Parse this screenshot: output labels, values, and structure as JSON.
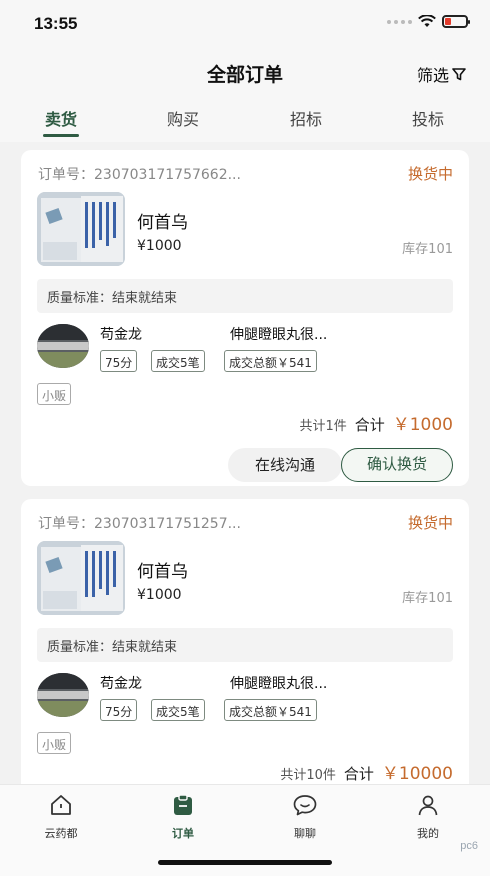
{
  "status_bar": {
    "time": "13:55"
  },
  "header": {
    "title": "全部订单",
    "filter_label": "筛选"
  },
  "tabs": [
    {
      "label": "卖货",
      "active": true
    },
    {
      "label": "购买",
      "active": false
    },
    {
      "label": "招标",
      "active": false
    },
    {
      "label": "投标",
      "active": false
    }
  ],
  "orders": [
    {
      "order_no": "订单号：230703171757662...",
      "status": "换货中",
      "product_name": "何首乌",
      "price": "¥1000",
      "stock": "库存101",
      "quality": "质量标准：结束就结束",
      "seller_name": "苟金龙",
      "seller_desc": "伸腿瞪眼丸很...",
      "tags": [
        "75分",
        "成交5笔",
        "成交总额￥541"
      ],
      "type_tag": "小贩",
      "total_count": "共计1件",
      "total_label": "合计",
      "total_amount": "￥1000",
      "btn_chat": "在线沟通",
      "btn_confirm": "确认换货"
    },
    {
      "order_no": "订单号：230703171751257...",
      "status": "换货中",
      "product_name": "何首乌",
      "price": "¥1000",
      "stock": "库存101",
      "quality": "质量标准：结束就结束",
      "seller_name": "苟金龙",
      "seller_desc": "伸腿瞪眼丸很...",
      "tags": [
        "75分",
        "成交5笔",
        "成交总额￥541"
      ],
      "type_tag": "小贩",
      "total_count": "共计10件",
      "total_label": "合计",
      "total_amount": "￥10000"
    }
  ],
  "tabbar": [
    {
      "label": "云药都",
      "icon": "home-icon",
      "active": false
    },
    {
      "label": "订单",
      "icon": "order-icon",
      "active": true
    },
    {
      "label": "聊聊",
      "icon": "chat-icon",
      "active": false
    },
    {
      "label": "我的",
      "icon": "profile-icon",
      "active": false
    }
  ],
  "colors": {
    "accent": "#2f5b43",
    "status": "#c56b2e"
  },
  "watermark": "pc6"
}
